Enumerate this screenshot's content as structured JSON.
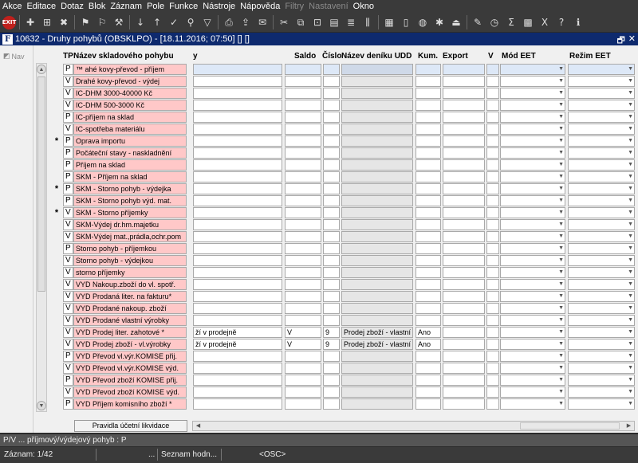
{
  "menu": [
    {
      "label": "Akce",
      "disabled": false
    },
    {
      "label": "Editace",
      "disabled": false
    },
    {
      "label": "Dotaz",
      "disabled": false
    },
    {
      "label": "Blok",
      "disabled": false
    },
    {
      "label": "Záznam",
      "disabled": false
    },
    {
      "label": "Pole",
      "disabled": false
    },
    {
      "label": "Funkce",
      "disabled": false
    },
    {
      "label": "Nástroje",
      "disabled": false
    },
    {
      "label": "Nápověda",
      "disabled": false
    },
    {
      "label": "Filtry",
      "disabled": true
    },
    {
      "label": "Nastavení",
      "disabled": true
    },
    {
      "label": "Okno",
      "disabled": false
    }
  ],
  "toolbar": {
    "exit_label": "EXIT",
    "icons": [
      "new-record-icon",
      "insert-record-icon",
      "delete-record-icon",
      "sep",
      "query-icon",
      "execute-query-icon",
      "cancel-query-icon",
      "sep",
      "sort-asc-icon",
      "sort-desc-icon",
      "checkmark-icon",
      "search-icon",
      "filter-icon",
      "sep",
      "print-icon",
      "export-icon",
      "mail-icon",
      "sep",
      "cut-icon",
      "copy-icon",
      "paste-icon",
      "clipboard-icon",
      "list-icon",
      "columns-icon",
      "sep",
      "calculator-icon",
      "document-icon",
      "globe-icon",
      "gear-icon",
      "eject-icon",
      "sep",
      "edit-icon",
      "clock-icon",
      "sum-icon",
      "chart-icon",
      "excel-icon",
      "help-icon",
      "info-icon"
    ],
    "glyphs": [
      "✚",
      "⊞",
      "✖",
      "",
      "⚑",
      "⚐",
      "⚒",
      "",
      "↓",
      "↑",
      "✓",
      "⚲",
      "▽",
      "",
      "⎙",
      "⇪",
      "✉",
      "",
      "✂",
      "⧉",
      "⊡",
      "▤",
      "≣",
      "⫼",
      "",
      "▦",
      "▯",
      "◍",
      "✱",
      "⏏",
      "",
      "✎",
      "◷",
      "Σ",
      "▩",
      "X",
      "?",
      "ℹ"
    ]
  },
  "titlebar": {
    "app_letter": "F",
    "title": "10632 - Druhy pohybů (OBSKLPO) - [18.11.2016; 07:50] [] []",
    "restore": "🗗",
    "close": "✕"
  },
  "nav": {
    "label": "Nav"
  },
  "columns": {
    "tp": "TP",
    "name": "Název skladového pohybu",
    "c1": "y",
    "c2": "Saldo",
    "c3": "Číslo",
    "c4": "Název deníku UDD",
    "c5": "Kum.",
    "c6": "Export",
    "c7": "V",
    "c8": "Mód EET",
    "c9": "Režim EET"
  },
  "rows": [
    {
      "mark": "",
      "tp": "P",
      "name": "™ ahé kovy-převod - příjem",
      "c1": "",
      "c2": "",
      "c3": "",
      "c4": "",
      "c5": "",
      "c6": "",
      "selected": true
    },
    {
      "mark": "",
      "tp": "V",
      "name": "Drahé kovy-převod - výdej",
      "c1": "",
      "c2": "",
      "c3": "",
      "c4": "",
      "c5": "",
      "c6": ""
    },
    {
      "mark": "",
      "tp": "V",
      "name": "IC-DHM 3000-40000 Kč",
      "c1": "",
      "c2": "",
      "c3": "",
      "c4": "",
      "c5": "",
      "c6": ""
    },
    {
      "mark": "",
      "tp": "V",
      "name": "IC-DHM 500-3000 Kč",
      "c1": "",
      "c2": "",
      "c3": "",
      "c4": "",
      "c5": "",
      "c6": ""
    },
    {
      "mark": "",
      "tp": "P",
      "name": "IC-příjem na sklad",
      "c1": "",
      "c2": "",
      "c3": "",
      "c4": "",
      "c5": "",
      "c6": ""
    },
    {
      "mark": "",
      "tp": "V",
      "name": "IC-spotřeba materiálu",
      "c1": "",
      "c2": "",
      "c3": "",
      "c4": "",
      "c5": "",
      "c6": ""
    },
    {
      "mark": "*",
      "tp": "P",
      "name": "Oprava importu",
      "c1": "",
      "c2": "",
      "c3": "",
      "c4": "",
      "c5": "",
      "c6": ""
    },
    {
      "mark": "",
      "tp": "P",
      "name": "Počáteční stavy - naskladnění",
      "c1": "",
      "c2": "",
      "c3": "",
      "c4": "",
      "c5": "",
      "c6": ""
    },
    {
      "mark": "",
      "tp": "P",
      "name": "Příjem na sklad",
      "c1": "",
      "c2": "",
      "c3": "",
      "c4": "",
      "c5": "",
      "c6": ""
    },
    {
      "mark": "",
      "tp": "P",
      "name": "SKM - Příjem na sklad",
      "c1": "",
      "c2": "",
      "c3": "",
      "c4": "",
      "c5": "",
      "c6": ""
    },
    {
      "mark": "*",
      "tp": "P",
      "name": "SKM - Storno pohyb - výdejka",
      "c1": "",
      "c2": "",
      "c3": "",
      "c4": "",
      "c5": "",
      "c6": ""
    },
    {
      "mark": "",
      "tp": "P",
      "name": "SKM - Storno pohyb výd. mat.",
      "c1": "",
      "c2": "",
      "c3": "",
      "c4": "",
      "c5": "",
      "c6": ""
    },
    {
      "mark": "*",
      "tp": "V",
      "name": "SKM - Storno příjemky",
      "c1": "",
      "c2": "",
      "c3": "",
      "c4": "",
      "c5": "",
      "c6": ""
    },
    {
      "mark": "",
      "tp": "V",
      "name": "SKM-Výdej dr.hm.majetku",
      "c1": "",
      "c2": "",
      "c3": "",
      "c4": "",
      "c5": "",
      "c6": ""
    },
    {
      "mark": "",
      "tp": "V",
      "name": "SKM-Výdej mat.,prádla,ochr.pom",
      "c1": "",
      "c2": "",
      "c3": "",
      "c4": "",
      "c5": "",
      "c6": ""
    },
    {
      "mark": "",
      "tp": "P",
      "name": "Storno pohyb - příjemkou",
      "c1": "",
      "c2": "",
      "c3": "",
      "c4": "",
      "c5": "",
      "c6": ""
    },
    {
      "mark": "",
      "tp": "V",
      "name": "Storno pohyb - výdejkou",
      "c1": "",
      "c2": "",
      "c3": "",
      "c4": "",
      "c5": "",
      "c6": ""
    },
    {
      "mark": "",
      "tp": "V",
      "name": "storno příjemky",
      "c1": "",
      "c2": "",
      "c3": "",
      "c4": "",
      "c5": "",
      "c6": ""
    },
    {
      "mark": "",
      "tp": "V",
      "name": "VYD Nakoup.zboží do vl. spotř.",
      "c1": "",
      "c2": "",
      "c3": "",
      "c4": "",
      "c5": "",
      "c6": ""
    },
    {
      "mark": "",
      "tp": "V",
      "name": "VYD Prodaná liter. na fakturu*",
      "c1": "",
      "c2": "",
      "c3": "",
      "c4": "",
      "c5": "",
      "c6": ""
    },
    {
      "mark": "",
      "tp": "V",
      "name": "VYD Prodané nakoup. zboží",
      "c1": "",
      "c2": "",
      "c3": "",
      "c4": "",
      "c5": "",
      "c6": ""
    },
    {
      "mark": "",
      "tp": "V",
      "name": "VYD Prodané vlastní výrobky",
      "c1": "",
      "c2": "",
      "c3": "",
      "c4": "",
      "c5": "",
      "c6": ""
    },
    {
      "mark": "",
      "tp": "V",
      "name": "VYD Prodej liter. zahotové *",
      "c1": "ží v prodejně",
      "c2": "V",
      "c3": "9",
      "c4": "Prodej zboží - vlastní pr",
      "c5": "Ano",
      "c6": ""
    },
    {
      "mark": "",
      "tp": "V",
      "name": "VYD Prodej zboží - vl.výrobky",
      "c1": "ží v prodejně",
      "c2": "V",
      "c3": "9",
      "c4": "Prodej zboží - vlastní pr",
      "c5": "Ano",
      "c6": ""
    },
    {
      "mark": "",
      "tp": "P",
      "name": "VYD Převod vl.výr.KOMISE přij.",
      "c1": "",
      "c2": "",
      "c3": "",
      "c4": "",
      "c5": "",
      "c6": ""
    },
    {
      "mark": "",
      "tp": "V",
      "name": "VYD Převod vl.výr.KOMISE výd.",
      "c1": "",
      "c2": "",
      "c3": "",
      "c4": "",
      "c5": "",
      "c6": ""
    },
    {
      "mark": "",
      "tp": "P",
      "name": "VYD Převod zboží KOMISE přij.",
      "c1": "",
      "c2": "",
      "c3": "",
      "c4": "",
      "c5": "",
      "c6": ""
    },
    {
      "mark": "",
      "tp": "V",
      "name": "VYD Převod zboží KOMISE výd.",
      "c1": "",
      "c2": "",
      "c3": "",
      "c4": "",
      "c5": "",
      "c6": ""
    },
    {
      "mark": "",
      "tp": "P",
      "name": "VYD Příjem komisního zboží *",
      "c1": "",
      "c2": "",
      "c3": "",
      "c4": "",
      "c5": "",
      "c6": ""
    }
  ],
  "bottom_button": "Pravidla účetní likvidace",
  "hint": "P/V ... příjmový/výdejový pohyb : P",
  "status": {
    "record": "Záznam: 1/42",
    "dots": "...",
    "list": "Seznam hodn...",
    "osc": "<OSC>"
  }
}
